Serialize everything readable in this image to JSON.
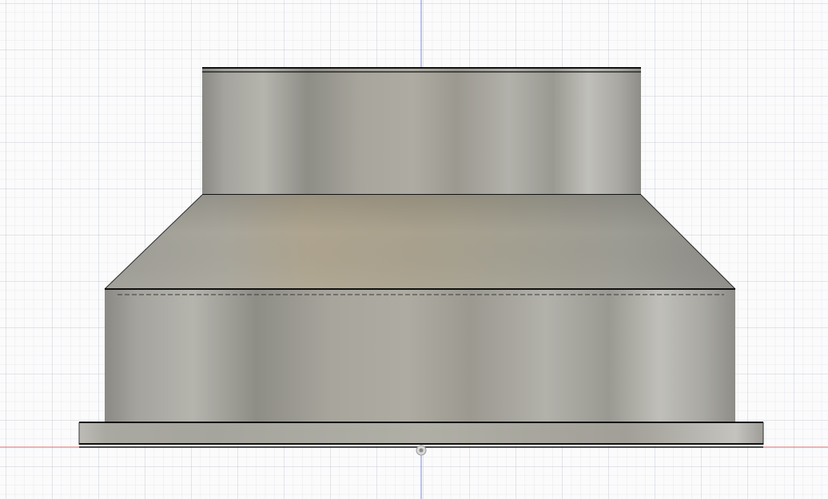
{
  "viewport": {
    "background_color": "#fbfbfc",
    "minor_grid_color": "#e6e8ec",
    "major_grid_color": "#c9ccd3",
    "axis_x_color": "#e07070",
    "axis_y_color": "#7b86e6",
    "origin_marker_icon": "origin-pivot-icon"
  },
  "model": {
    "body_color": "#a3a29a",
    "edge_color": "#111111",
    "parts": [
      "top-collar",
      "conical-transition",
      "base-cylinder",
      "bottom-flange"
    ]
  }
}
